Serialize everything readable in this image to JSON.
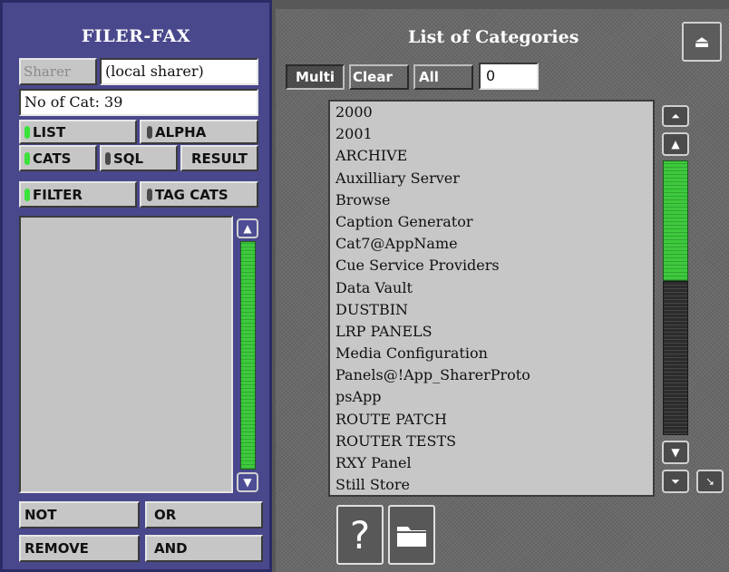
{
  "left_panel": {
    "title": "FILER-FAX",
    "sharer_button": "Sharer",
    "sharer_value": "(local sharer)",
    "cat_count": "No of Cat: 39",
    "buttons": {
      "list": "LIST",
      "alpha": "ALPHA",
      "cats": "CATS",
      "sql": "SQL",
      "result": "RESULT",
      "filter": "FILTER",
      "tag_cats": "TAG CATS",
      "not": "NOT",
      "or": "OR",
      "remove": "REMOVE",
      "and": "AND"
    },
    "toggles": {
      "list": true,
      "alpha": false,
      "cats": true,
      "sql": false,
      "filter": true,
      "tag_cats": false
    }
  },
  "right_panel": {
    "title": "List of Categories",
    "multi_button": "Multi",
    "clear_button": "Clear",
    "all_button": "All",
    "count_value": "0",
    "categories": [
      "2000",
      "2001",
      "ARCHIVE",
      "Auxilliary Server",
      "Browse",
      "Caption Generator",
      "Cat7@AppName",
      "Cue Service Providers",
      "Data Vault",
      "DUSTBIN",
      "LRP PANELS",
      "Media Configuration",
      "Panels@!App_SharerProto",
      "psApp",
      "ROUTE PATCH",
      "ROUTER TESTS",
      "RXY Panel",
      "Still Store"
    ],
    "help_glyph": "?"
  },
  "colors": {
    "left_panel_bg": "#49488c",
    "scroll_green": "#3dca3d",
    "led_on": "#3ae23a",
    "led_off": "#4a4a4a"
  },
  "icons": [
    "eject-icon",
    "scroll-top-icon",
    "scroll-up-icon",
    "scroll-down-icon",
    "scroll-bottom-icon",
    "resize-corner-icon",
    "help-icon",
    "folder-icon"
  ]
}
